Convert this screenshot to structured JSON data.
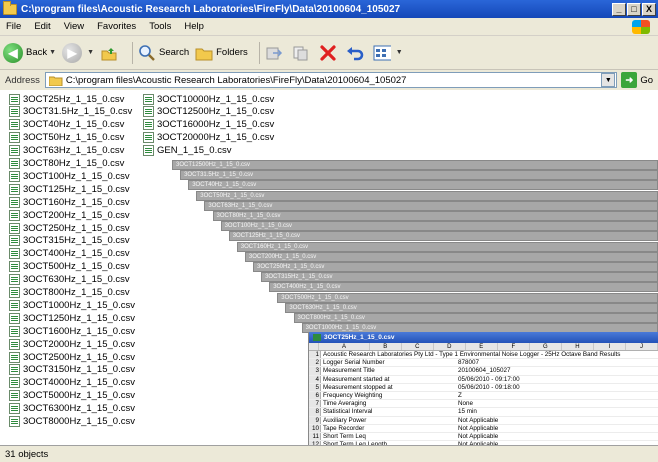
{
  "window": {
    "title": "C:\\program files\\Acoustic Research Laboratories\\FireFly\\Data\\20100604_105027",
    "minimize": "_",
    "maximize": "□",
    "close": "X"
  },
  "menu": {
    "file": "File",
    "edit": "Edit",
    "view": "View",
    "favorites": "Favorites",
    "tools": "Tools",
    "help": "Help"
  },
  "toolbar": {
    "back_label": "Back",
    "search_label": "Search",
    "folders_label": "Folders"
  },
  "address": {
    "label": "Address",
    "value": "C:\\program files\\Acoustic Research Laboratories\\FireFly\\Data\\20100604_105027",
    "go_label": "Go"
  },
  "files_col1": [
    "3OCT25Hz_1_15_0.csv",
    "3OCT31.5Hz_1_15_0.csv",
    "3OCT40Hz_1_15_0.csv",
    "3OCT50Hz_1_15_0.csv",
    "3OCT63Hz_1_15_0.csv",
    "3OCT80Hz_1_15_0.csv",
    "3OCT100Hz_1_15_0.csv",
    "3OCT125Hz_1_15_0.csv",
    "3OCT160Hz_1_15_0.csv",
    "3OCT200Hz_1_15_0.csv",
    "3OCT250Hz_1_15_0.csv",
    "3OCT315Hz_1_15_0.csv",
    "3OCT400Hz_1_15_0.csv",
    "3OCT500Hz_1_15_0.csv",
    "3OCT630Hz_1_15_0.csv",
    "3OCT800Hz_1_15_0.csv",
    "3OCT1000Hz_1_15_0.csv",
    "3OCT1250Hz_1_15_0.csv",
    "3OCT1600Hz_1_15_0.csv",
    "3OCT2000Hz_1_15_0.csv",
    "3OCT2500Hz_1_15_0.csv",
    "3OCT3150Hz_1_15_0.csv",
    "3OCT4000Hz_1_15_0.csv",
    "3OCT5000Hz_1_15_0.csv",
    "3OCT6300Hz_1_15_0.csv",
    "3OCT8000Hz_1_15_0.csv"
  ],
  "files_col2": [
    "3OCT10000Hz_1_15_0.csv",
    "3OCT12500Hz_1_15_0.csv",
    "3OCT16000Hz_1_15_0.csv",
    "3OCT20000Hz_1_15_0.csv",
    "GEN_1_15_0.csv"
  ],
  "excel_windows": [
    "3OCT12500Hz_1_15_0.csv",
    "3OCT31.5Hz_1_15_0.csv",
    "3OCT40Hz_1_15_0.csv",
    "3OCT50Hz_1_15_0.csv",
    "3OCT63Hz_1_15_0.csv",
    "3OCT80Hz_1_15_0.csv",
    "3OCT100Hz_1_15_0.csv",
    "3OCT125Hz_1_15_0.csv",
    "3OCT160Hz_1_15_0.csv",
    "3OCT200Hz_1_15_0.csv",
    "3OCT250Hz_1_15_0.csv",
    "3OCT315Hz_1_15_0.csv",
    "3OCT400Hz_1_15_0.csv",
    "3OCT500Hz_1_15_0.csv",
    "3OCT630Hz_1_15_0.csv",
    "3OCT800Hz_1_15_0.csv",
    "3OCT1000Hz_1_15_0.csv"
  ],
  "sheet": {
    "title": "3OCT25Hz_1_15_0.csv",
    "columns": [
      "A",
      "B",
      "C",
      "D",
      "E",
      "F",
      "G",
      "H",
      "I",
      "J"
    ],
    "rows": [
      {
        "n": "1",
        "a": "Acoustic Research Laboratories Pty Ltd - Type 1 Environmental Noise Logger - 25Hz Octave Band Results",
        "v": ""
      },
      {
        "n": "2",
        "a": "Logger Serial Number",
        "v": "878007"
      },
      {
        "n": "3",
        "a": "Measurement Title",
        "v": "20100604_105027"
      },
      {
        "n": "4",
        "a": "Measurement started at",
        "v": "05/06/2010 - 09:17:00"
      },
      {
        "n": "5",
        "a": "Measurement stopped at",
        "v": "05/06/2010 - 09:18:00"
      },
      {
        "n": "6",
        "a": "Frequency Weighting",
        "v": "Z"
      },
      {
        "n": "7",
        "a": "Time Averaging",
        "v": "None"
      },
      {
        "n": "8",
        "a": "Statistical Interval",
        "v": "15 min"
      },
      {
        "n": "9",
        "a": "Auxiliary Power",
        "v": "Not Applicable"
      },
      {
        "n": "10",
        "a": "Tape Recorder",
        "v": "Not Applicable"
      },
      {
        "n": "11",
        "a": "Short Term Leq",
        "v": "Not Applicable"
      },
      {
        "n": "12",
        "a": "Short Term Leq Length",
        "v": "Not Applicable"
      }
    ]
  },
  "status": {
    "objects": "31 objects"
  }
}
